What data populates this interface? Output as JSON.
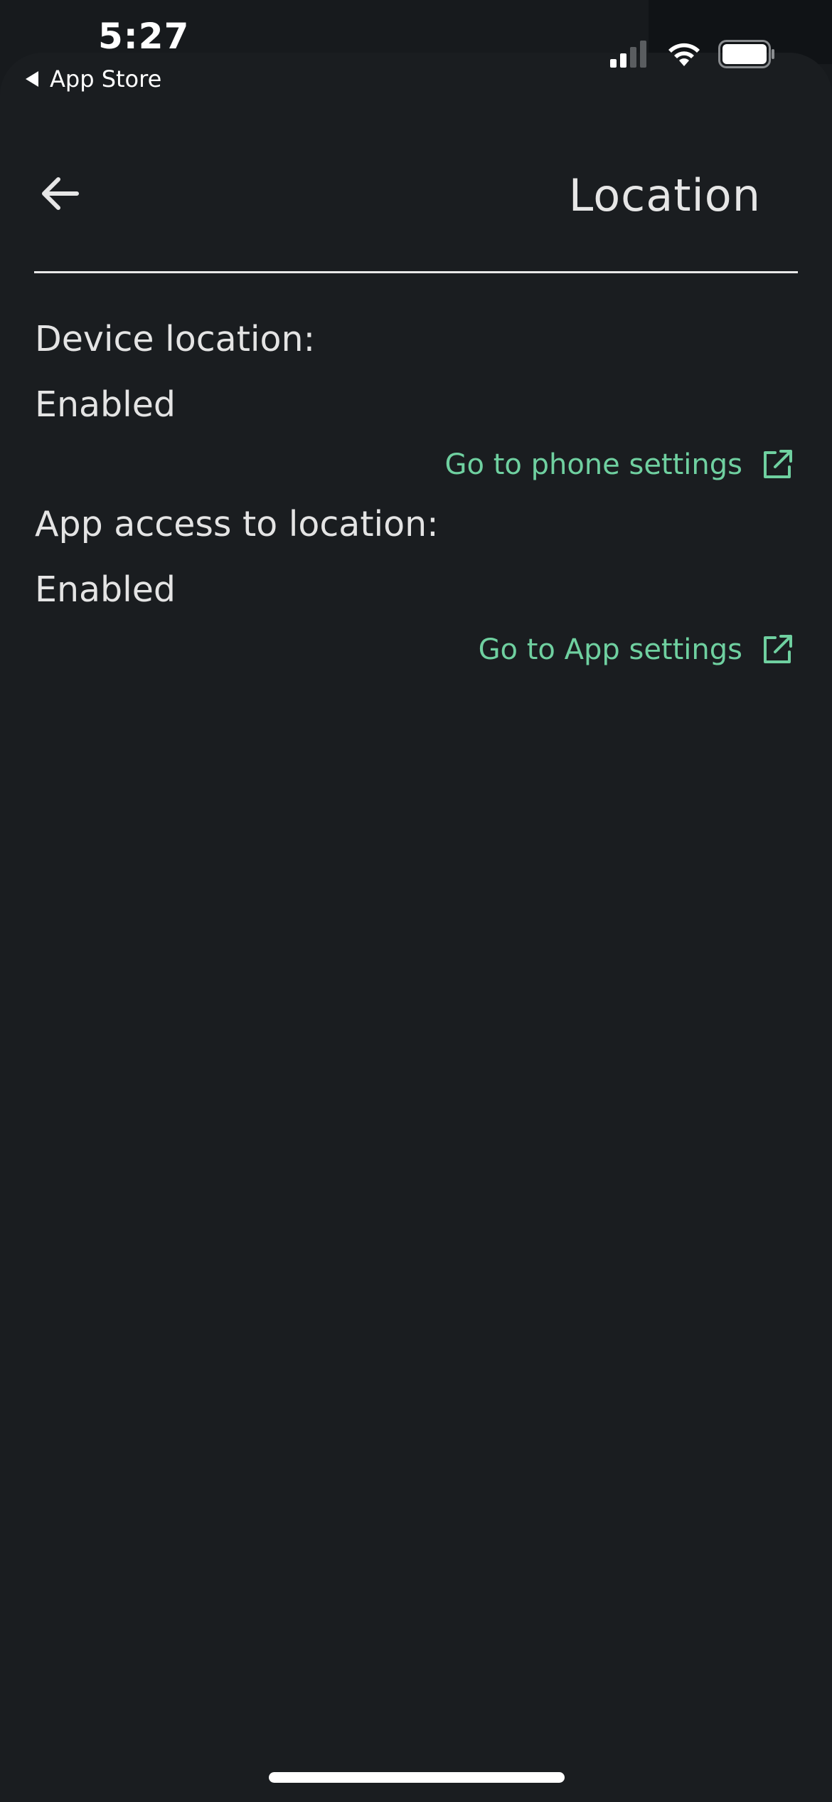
{
  "status_bar": {
    "time": "5:27",
    "back_app_label": "App Store",
    "signal_icon": "cellular-signal-icon",
    "wifi_icon": "wifi-icon",
    "battery_icon": "battery-icon"
  },
  "header": {
    "title": "Location",
    "back_icon": "arrow-left-icon"
  },
  "sections": [
    {
      "label": "Device location:",
      "value": "Enabled",
      "link_label": "Go to phone settings",
      "link_icon": "external-link-icon"
    },
    {
      "label": "App access to location:",
      "value": "Enabled",
      "link_label": "Go to App settings",
      "link_icon": "external-link-icon"
    }
  ],
  "colors": {
    "background": "#1a1d20",
    "accent": "#6fd0a0",
    "text": "#e4e4e4"
  }
}
